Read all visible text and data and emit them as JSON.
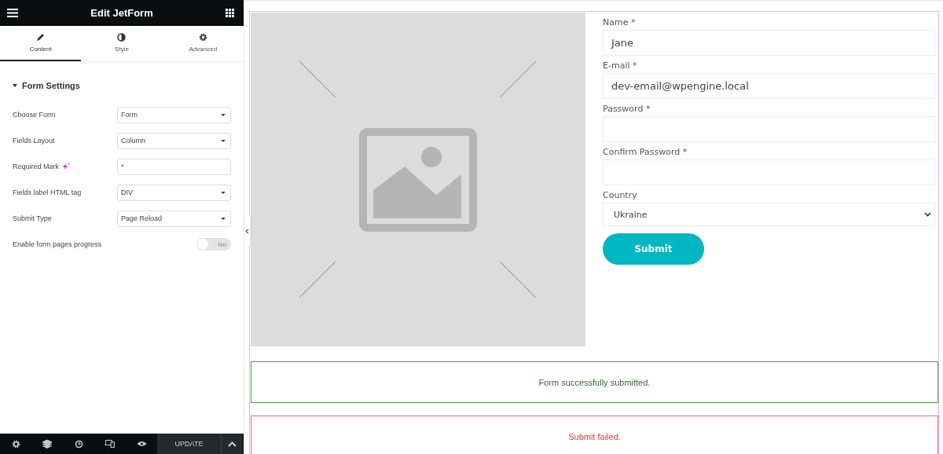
{
  "panel": {
    "title": "Edit JetForm",
    "tabs": [
      {
        "label": "Content",
        "selected": true
      },
      {
        "label": "Style",
        "selected": false
      },
      {
        "label": "Advanced",
        "selected": false
      }
    ],
    "section": {
      "title": "Form Settings",
      "expanded": true
    },
    "settings": [
      {
        "kind": "select",
        "label": "Choose Form",
        "value": "Form"
      },
      {
        "kind": "select",
        "label": "Fields Layout",
        "value": "Column"
      },
      {
        "kind": "text",
        "label": "Required Mark",
        "value": "*",
        "ai": true
      },
      {
        "kind": "select",
        "label": "Fields label HTML tag",
        "value": "DIV"
      },
      {
        "kind": "select",
        "label": "Submit Type",
        "value": "Page Reload"
      },
      {
        "kind": "toggle",
        "label": "Enable form pages progress",
        "on": false,
        "state_label": "No"
      }
    ],
    "footer": {
      "update": "UPDATE"
    }
  },
  "form": {
    "fields": [
      {
        "kind": "input",
        "label": "Name *",
        "value": "Jane"
      },
      {
        "kind": "input",
        "label": "E-mail *",
        "value": "dev-email@wpengine.local"
      },
      {
        "kind": "input",
        "label": "Password *"
      },
      {
        "kind": "input",
        "label": "Confirm Password *"
      },
      {
        "kind": "select",
        "label": "Country",
        "value": "Ukraine"
      }
    ],
    "submit": "Submit"
  },
  "messages": [
    {
      "kind": "success",
      "text": "Form successfully submitted."
    },
    {
      "kind": "error",
      "text": "Submit failed."
    }
  ]
}
